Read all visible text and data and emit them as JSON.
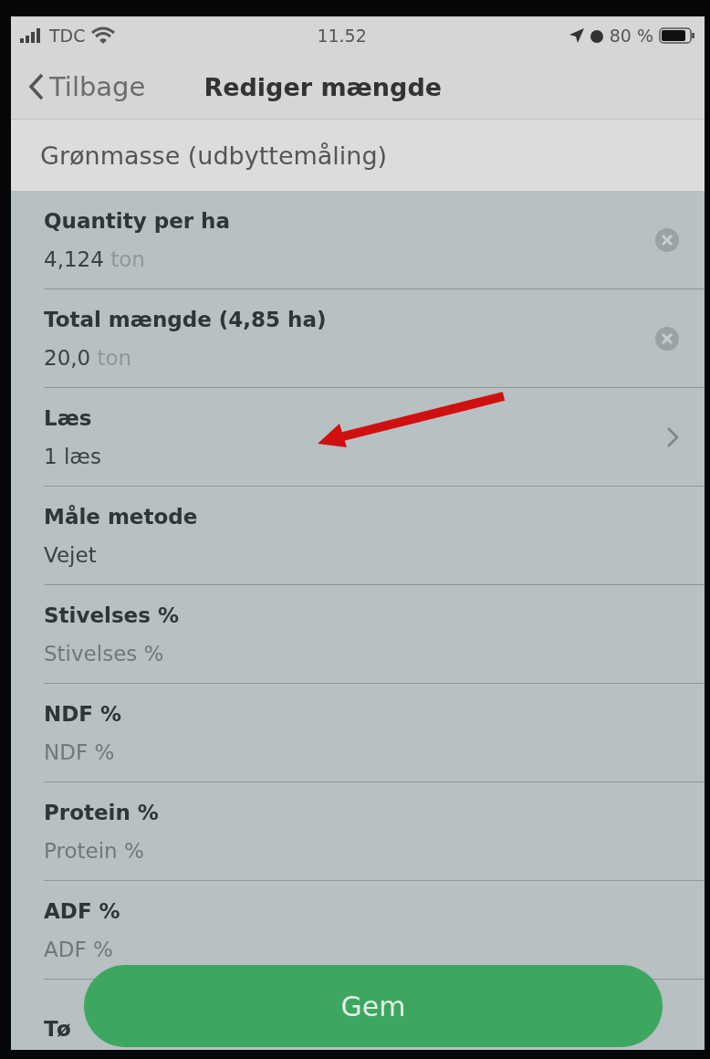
{
  "status_bar": {
    "carrier": "TDC",
    "time": "11.52",
    "battery": "80 %"
  },
  "nav": {
    "back": "Tilbage",
    "title": "Rediger mængde"
  },
  "header": {
    "title": "Grønmasse (udbyttemåling)"
  },
  "fields": [
    {
      "kind": "input",
      "label": "Quantity per ha",
      "value": "4,124",
      "unit": "ton"
    },
    {
      "kind": "input",
      "label": "Total mængde (4,85 ha)",
      "value": "20,0",
      "unit": "ton"
    },
    {
      "kind": "link",
      "label": "Læs",
      "value": "1 læs"
    },
    {
      "kind": "plain",
      "label": "Måle metode",
      "value": "Vejet"
    },
    {
      "kind": "empty",
      "label": "Stivelses %",
      "placeholder": "Stivelses %"
    },
    {
      "kind": "empty",
      "label": "NDF %",
      "placeholder": "NDF %"
    },
    {
      "kind": "empty",
      "label": "Protein %",
      "placeholder": "Protein %"
    },
    {
      "kind": "empty",
      "label": "ADF %",
      "placeholder": "ADF %"
    },
    {
      "kind": "label",
      "label": "Tø"
    }
  ],
  "save_button": "Gem"
}
